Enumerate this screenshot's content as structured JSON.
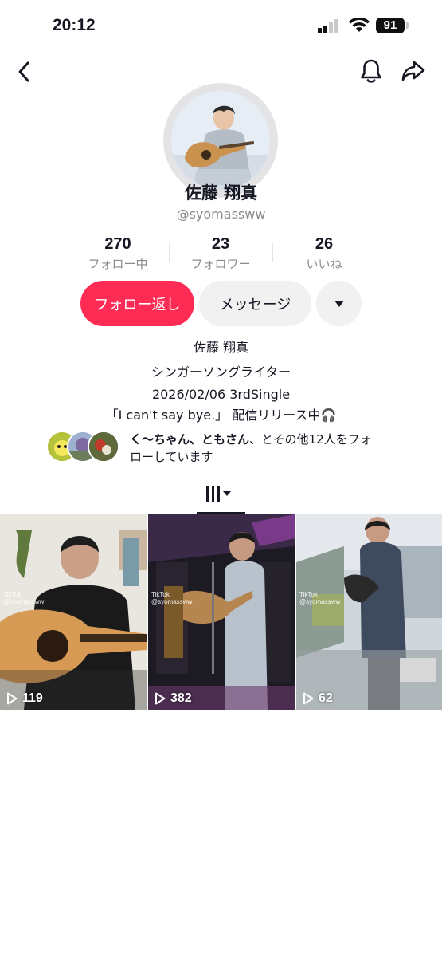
{
  "status": {
    "time": "20:12",
    "battery": "91"
  },
  "profile": {
    "display_name": "佐藤 翔真",
    "handle": "@syomassww"
  },
  "stats": [
    {
      "value": "270",
      "label": "フォロー中"
    },
    {
      "value": "23",
      "label": "フォロワー"
    },
    {
      "value": "26",
      "label": "いいね"
    }
  ],
  "actions": {
    "follow_back": "フォロー返し",
    "message": "メッセージ"
  },
  "bio": {
    "line1": "佐藤 翔真",
    "line2": "シンガーソングライター",
    "line3": "2026/02/06 3rdSingle",
    "line4": "「I can't say bye.」 配信リリース中🎧"
  },
  "mutuals": {
    "names": "く〜ちゃん、ともさん",
    "rest_line1": "、とその他12人をフォ",
    "rest_line2": "ローしています"
  },
  "videos": [
    {
      "views": "119",
      "watermark_brand": "TikTok",
      "watermark_user": "@syomassww"
    },
    {
      "views": "382",
      "watermark_brand": "TikTok",
      "watermark_user": "@syomassww"
    },
    {
      "views": "62",
      "watermark_brand": "TikTok",
      "watermark_user": "@syomassww"
    }
  ],
  "colors": {
    "accent": "#fe2c55",
    "secondary_button": "#f1f1f2",
    "muted_text": "#8a8b91"
  }
}
